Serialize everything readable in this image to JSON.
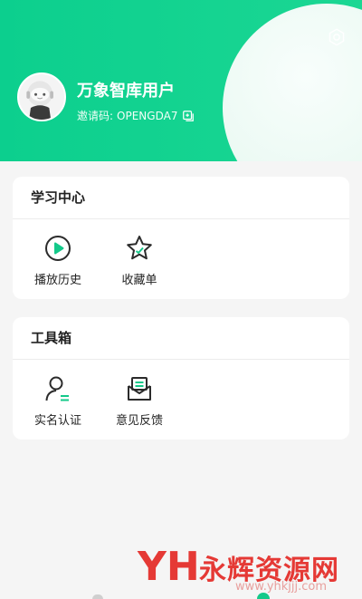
{
  "profile": {
    "username": "万象智库用户",
    "invite_label": "邀请码:",
    "invite_code": "OPENGDA7"
  },
  "study_center": {
    "title": "学习中心",
    "items": [
      {
        "label": "播放历史",
        "icon": "play-circle-icon"
      },
      {
        "label": "收藏单",
        "icon": "star-icon"
      }
    ]
  },
  "toolbox": {
    "title": "工具箱",
    "items": [
      {
        "label": "实名认证",
        "icon": "user-verify-icon"
      },
      {
        "label": "意见反馈",
        "icon": "feedback-envelope-icon"
      }
    ]
  },
  "watermark": {
    "logo": "YH",
    "name": "永辉资源网",
    "url": "www.yhkjjj.com"
  },
  "colors": {
    "brand_green": "#0ccf8e",
    "watermark_red": "#e53935"
  }
}
